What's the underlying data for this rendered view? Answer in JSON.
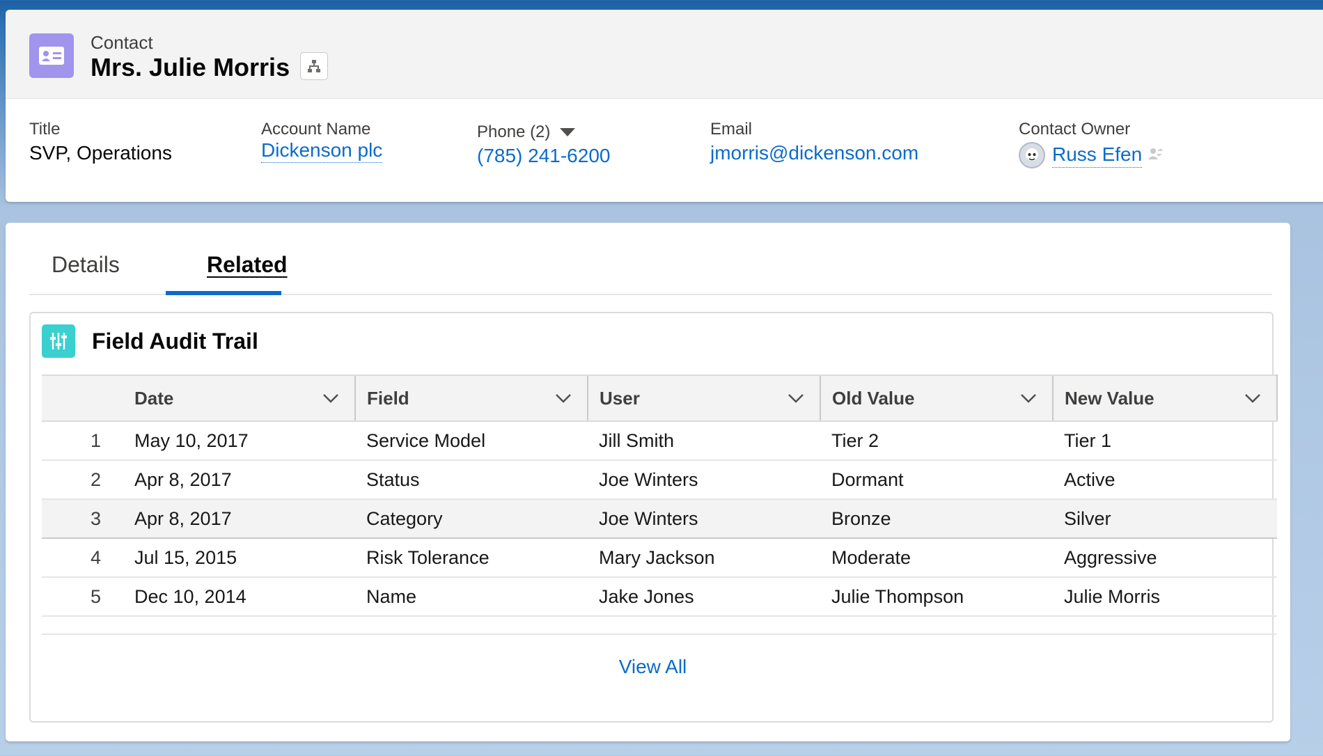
{
  "header": {
    "object_label": "Contact",
    "record_name": "Mrs. Julie Morris",
    "icons": {
      "object": "contact-card-icon",
      "hierarchy": "hierarchy-icon"
    }
  },
  "highlights": {
    "title": {
      "label": "Title",
      "value": "SVP, Operations"
    },
    "account": {
      "label": "Account Name",
      "value": "Dickenson plc"
    },
    "phone": {
      "label": "Phone (2)",
      "value": "(785) 241-6200"
    },
    "email": {
      "label": "Email",
      "value": "jmorris@dickenson.com"
    },
    "owner": {
      "label": "Contact Owner",
      "value": "Russ Efen"
    }
  },
  "tabs": [
    {
      "label": "Details",
      "active": false
    },
    {
      "label": "Related",
      "active": true
    }
  ],
  "related_list": {
    "title": "Field Audit Trail",
    "icon": "sliders-icon",
    "columns": [
      "Date",
      "Field",
      "User",
      "Old Value",
      "New Value"
    ],
    "rows": [
      {
        "num": "1",
        "date": "May 10, 2017",
        "field": "Service Model",
        "user": "Jill Smith",
        "old": "Tier 2",
        "new": "Tier 1"
      },
      {
        "num": "2",
        "date": "Apr 8, 2017",
        "field": "Status",
        "user": "Joe Winters",
        "old": "Dormant",
        "new": "Active"
      },
      {
        "num": "3",
        "date": "Apr 8, 2017",
        "field": "Category",
        "user": "Joe Winters",
        "old": "Bronze",
        "new": "Silver"
      },
      {
        "num": "4",
        "date": "Jul 15, 2015",
        "field": "Risk Tolerance",
        "user": "Mary Jackson",
        "old": "Moderate",
        "new": "Aggressive"
      },
      {
        "num": "5",
        "date": "Dec 10, 2014",
        "field": "Name",
        "user": "Jake Jones",
        "old": "Julie Thompson",
        "new": "Julie Morris"
      }
    ],
    "view_all": "View All"
  },
  "colors": {
    "link": "#0b6bcb",
    "contact_icon_bg": "#a094ed",
    "audit_icon_bg": "#3bd0d0",
    "tab_indicator": "#0b6bcb"
  }
}
